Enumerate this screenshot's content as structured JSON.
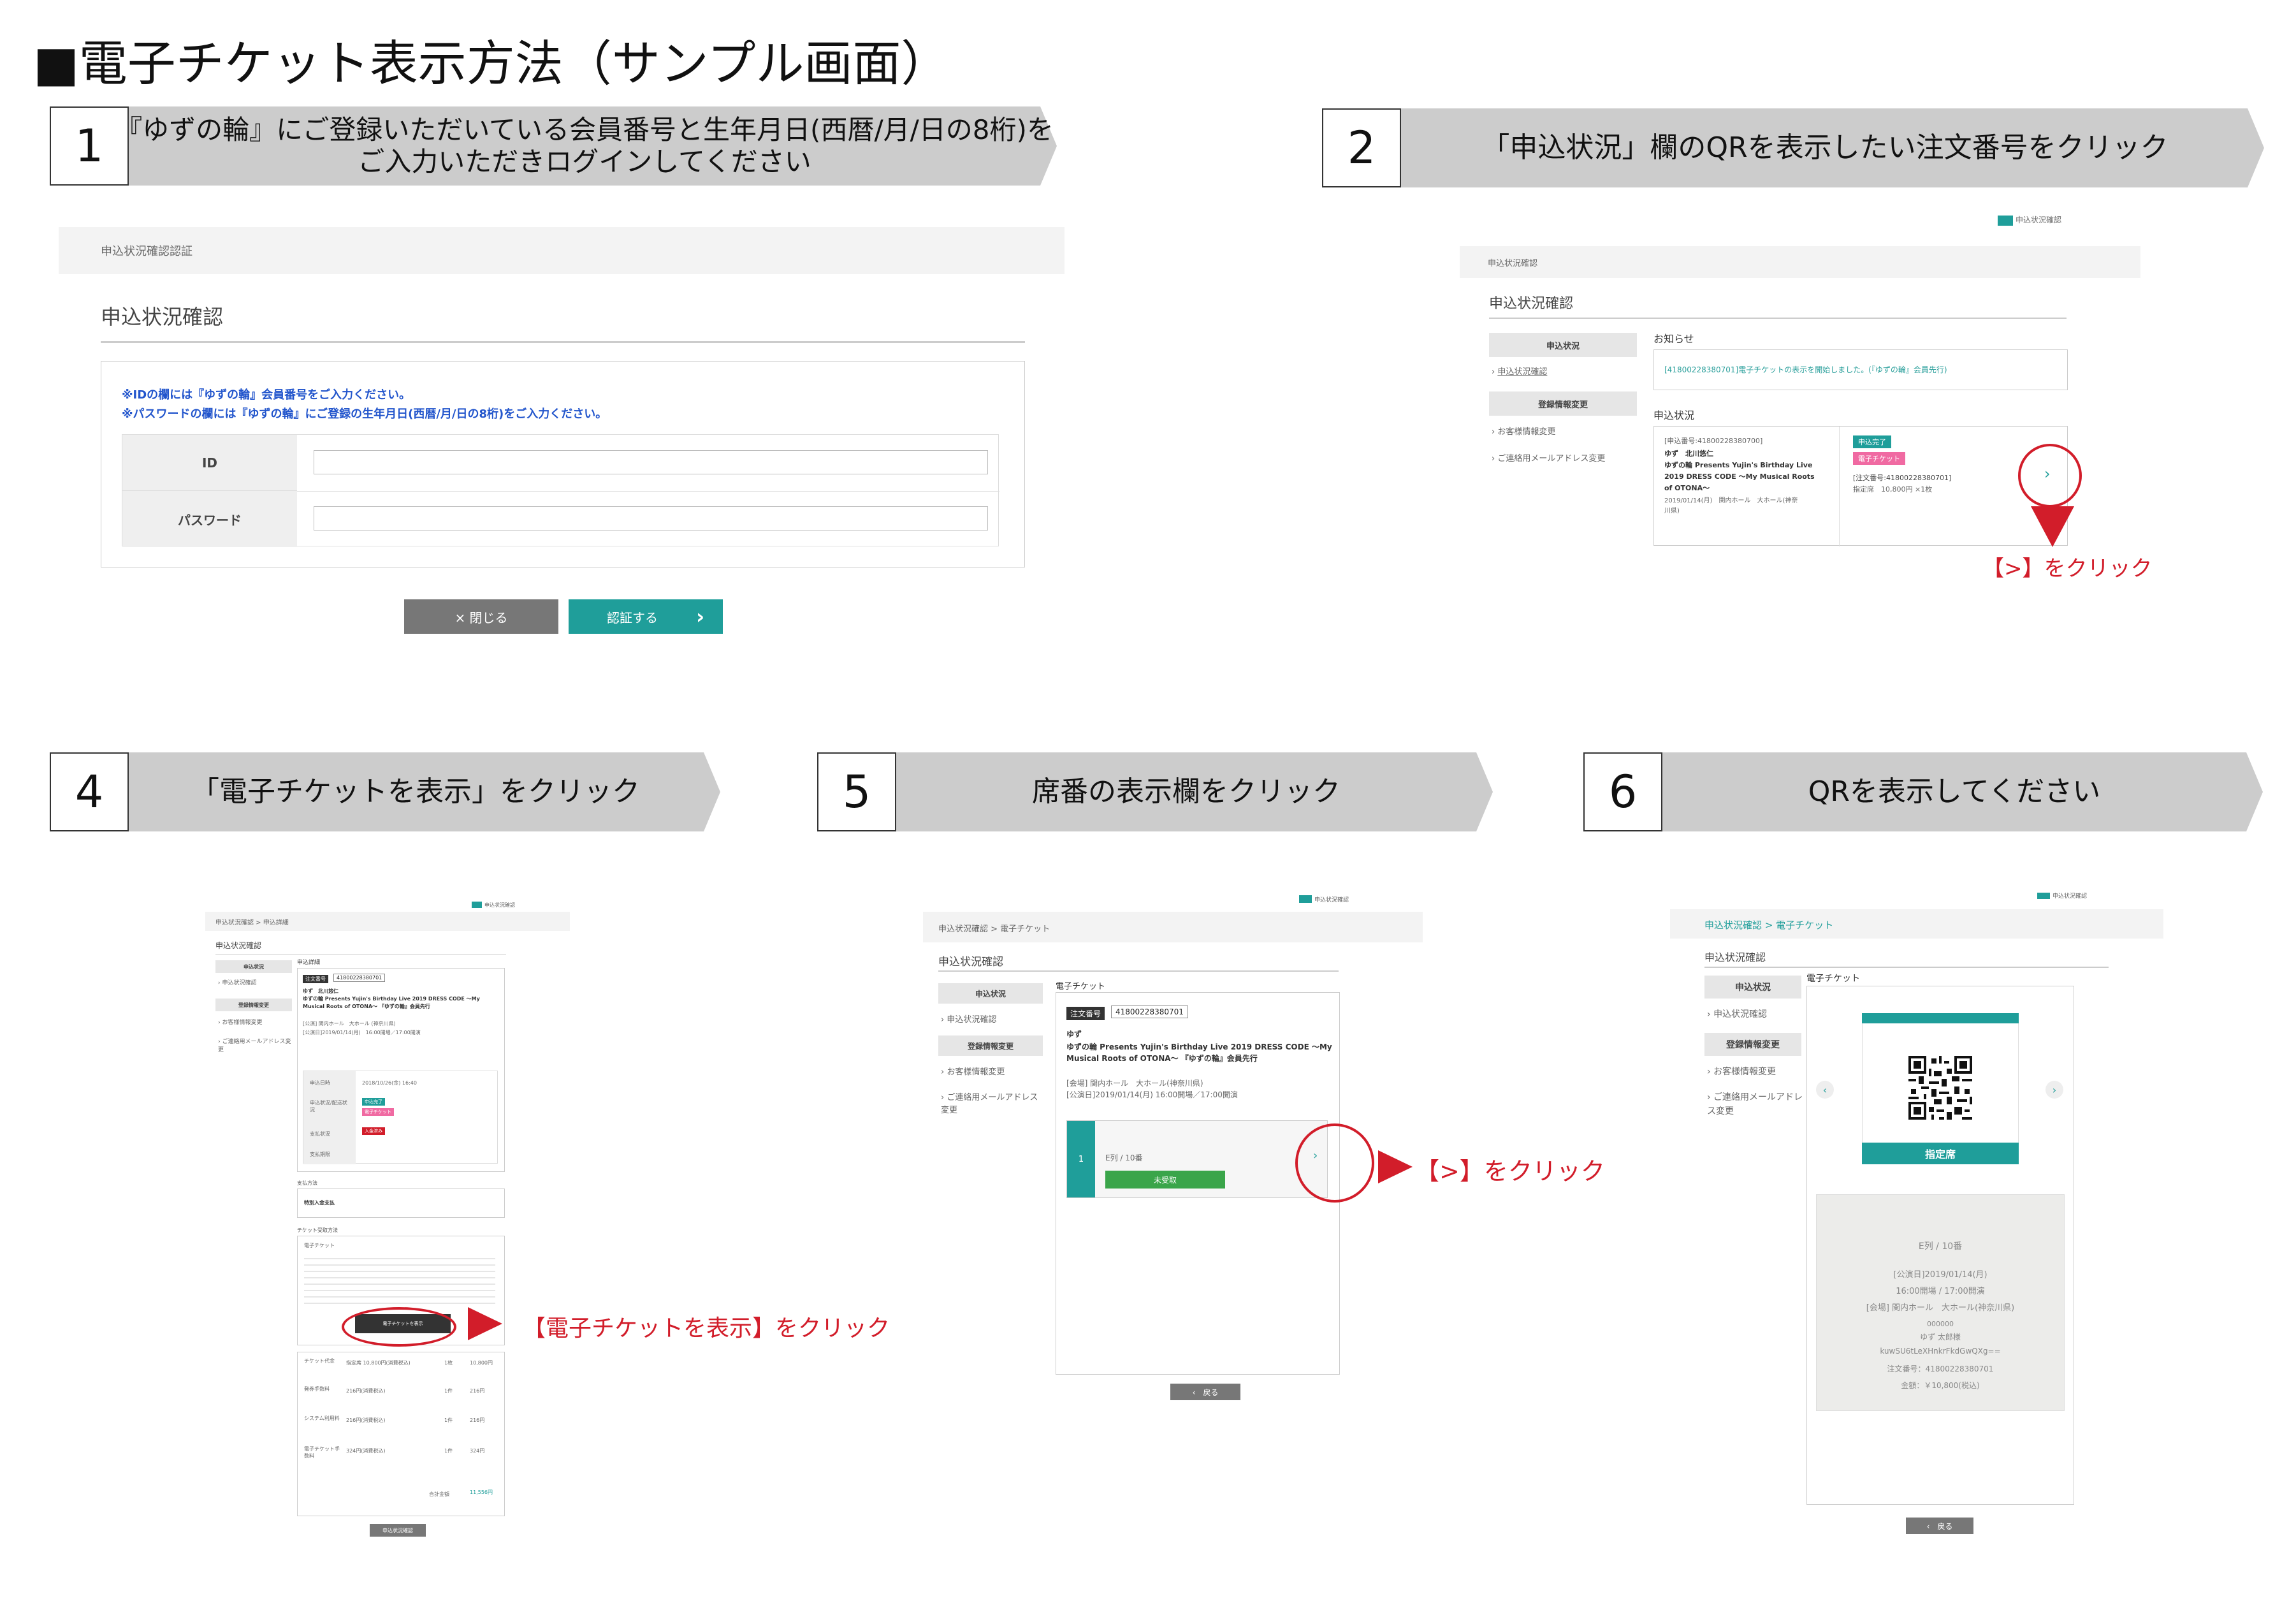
{
  "title": "■電子チケット表示方法（サンプル画面）",
  "steps": [
    {
      "num": "1",
      "text_line1": "『ゆずの輪』にご登録いただいている会員番号と生年月日(西暦/月/日の8桁)を",
      "text_line2": "ご入力いただきログインしてください"
    },
    {
      "num": "2",
      "text": "「申込状況」欄のQRを表示したい注文番号をクリック"
    },
    {
      "num": "4",
      "text": "「電子チケットを表示」をクリック"
    },
    {
      "num": "5",
      "text": "席番の表示欄をクリック"
    },
    {
      "num": "6",
      "text": "QRを表示してください"
    }
  ],
  "s1": {
    "breadcrumb": "申込状況確認認証",
    "heading": "申込状況確認",
    "note1": "※IDの欄には『ゆずの輪』会員番号をご入力ください。",
    "note2": "※パスワードの欄には『ゆずの輪』にご登録の生年月日(西暦/月/日の8桁)をご入力ください。",
    "id_label": "ID",
    "pw_label": "パスワード",
    "close_btn": "× 閉じる",
    "auth_btn": "認証する",
    "auth_arrow": "›"
  },
  "s2": {
    "top_link": "申込状況確認",
    "breadcrumb": "申込状況確認",
    "heading": "申込状況確認",
    "side_status": "申込状況",
    "side_status_link": "申込状況確認",
    "side_reg": "登録情報変更",
    "side_reg_link1": "お客様情報変更",
    "side_reg_link2": "ご連絡用メールアドレス変更",
    "notice_title": "お知らせ",
    "notice_text": "[41800228380701]電子チケットの表示を開始しました。(『ゆずの輪』会員先行)",
    "status_title": "申込状況",
    "order_no": "[申込番号:41800228380700]",
    "artist": "ゆず　北川悠仁",
    "event1": "ゆずの輪 Presents Yujin's Birthday Live",
    "event2": "2019 DRESS CODE ～My Musical Roots",
    "event3": "of OTONA～",
    "date": "2019/01/14(月)　関内ホール　大ホール(神奈",
    "date2": "川県)",
    "badge1": "申込完了",
    "badge2": "電子チケット",
    "order_no2": "[注文番号:41800228380701]",
    "seat": "指定席　10,800円 ×1枚",
    "chevron": "›",
    "callout": "【>】をクリック"
  },
  "s4": {
    "top_link": "申込状況確認",
    "breadcrumb": "申込状況確認 > 申込詳細",
    "heading": "申込状況確認",
    "side1": "申込状況",
    "link1": "申込状況確認",
    "side2": "登録情報変更",
    "link2": "お客様情報変更",
    "link3": "ご連絡用メールアドレス変更",
    "detail_title": "申込詳細",
    "order_label": "注文番号",
    "order_no": "41800228380701",
    "artist": "ゆず　北川悠仁",
    "event": "ゆずの輪 Presents Yujin's Birthday Live 2019 DRESS CODE ～My Musical Roots of OTONA～ 『ゆずの輪』会員先行",
    "venue": "[公演] 関内ホール　大ホール (神奈川県)",
    "perf": "[公演日]2019/01/14(月)　16:00開場／17:00開演",
    "row1_label": "申込日時",
    "row1_val": "2018/10/26(金) 16:40",
    "row2_label": "申込状況/配送状況",
    "row2_badge1": "申込完了",
    "row2_badge2": "電子チケット",
    "row3_label": "支払状況",
    "row3_badge": "入金済み",
    "row4_label": "支払期限",
    "pay_title": "支払方法",
    "pay_val": "特別入金支払",
    "recv_title": "チケット受取方法",
    "recv_val": "電子チケット",
    "show_btn": "電子チケットを表示",
    "callout": "【電子チケットを表示】をクリック",
    "fee1": "チケット代金",
    "fee1_v": "指定席 10,800円(消費税込)",
    "fee1_q": "1枚",
    "fee1_t": "10,800円",
    "fee2": "発券手数料",
    "fee2_v": "216円(消費税込)",
    "fee2_q": "1件",
    "fee2_t": "216円",
    "fee3": "システム利用料",
    "fee3_v": "216円(消費税込)",
    "fee3_q": "1件",
    "fee3_t": "216円",
    "fee4": "電子チケット手数料",
    "fee4_v": "324円(消費税込)",
    "fee4_q": "1件",
    "fee4_t": "324円",
    "total_label": "合計金額",
    "total": "11,556円",
    "back_btn": "申込状況確認"
  },
  "s5": {
    "top_link": "申込状況確認",
    "breadcrumb": "申込状況確認 > 電子チケット",
    "heading": "申込状況確認",
    "side1": "申込状況",
    "link1": "申込状況確認",
    "side2": "登録情報変更",
    "link2": "お客様情報変更",
    "link3": "ご連絡用メールアドレス変更",
    "et_title": "電子チケット",
    "order_label": "注文番号",
    "order_no": "41800228380701",
    "artist": "ゆず",
    "event": "ゆずの輪 Presents Yujin's Birthday Live 2019 DRESS CODE ～My Musical Roots of OTONA～ 『ゆずの輪』会員先行",
    "venue": "[会場] 関内ホール　大ホール(神奈川県)",
    "perf": "[公演日]2019/01/14(月) 16:00開場／17:00開演",
    "seat_idx": "1",
    "seat": "E列 / 10番",
    "unused": "未受取",
    "chevron": "›",
    "callout": "【>】をクリック",
    "back_btn": "‹　戻る"
  },
  "s6": {
    "top_link": "申込状況確認",
    "breadcrumb": "申込状況確認 > 電子チケット",
    "heading": "申込状況確認",
    "side1": "申込状況",
    "link1": "申込状況確認",
    "side2": "登録情報変更",
    "link2": "お客様情報変更",
    "link3": "ご連絡用メールアドレス変更",
    "et_title": "電子チケット",
    "seat_type": "指定席",
    "prev": "‹",
    "next": "›",
    "seat": "E列 / 10番",
    "perf": "[公演日]2019/01/14(月)",
    "time": "16:00開場 / 17:00開演",
    "venue": "[会場] 関内ホール　大ホール(神奈川県)",
    "code": "000000",
    "name": "ゆず 太郎様",
    "hash": "kuwSU6tLeXHnkrFkdGwQXg==",
    "order": "注文番号：41800228380701",
    "price": "金額：￥10,800(税込)",
    "back_btn": "‹　戻る"
  },
  "colors": {
    "accent": "#1f9e9a",
    "callout": "#d21d2a",
    "band": "#cccccc"
  }
}
